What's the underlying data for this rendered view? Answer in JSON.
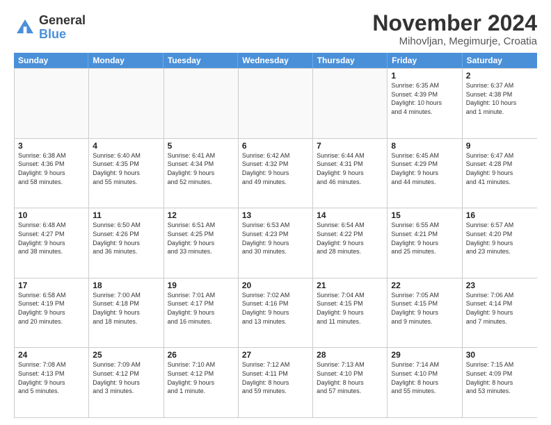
{
  "logo": {
    "general": "General",
    "blue": "Blue"
  },
  "title": "November 2024",
  "subtitle": "Mihovljan, Megimurje, Croatia",
  "headers": [
    "Sunday",
    "Monday",
    "Tuesday",
    "Wednesday",
    "Thursday",
    "Friday",
    "Saturday"
  ],
  "rows": [
    [
      {
        "day": "",
        "info": "",
        "empty": true
      },
      {
        "day": "",
        "info": "",
        "empty": true
      },
      {
        "day": "",
        "info": "",
        "empty": true
      },
      {
        "day": "",
        "info": "",
        "empty": true
      },
      {
        "day": "",
        "info": "",
        "empty": true
      },
      {
        "day": "1",
        "info": "Sunrise: 6:35 AM\nSunset: 4:39 PM\nDaylight: 10 hours\nand 4 minutes.",
        "empty": false
      },
      {
        "day": "2",
        "info": "Sunrise: 6:37 AM\nSunset: 4:38 PM\nDaylight: 10 hours\nand 1 minute.",
        "empty": false
      }
    ],
    [
      {
        "day": "3",
        "info": "Sunrise: 6:38 AM\nSunset: 4:36 PM\nDaylight: 9 hours\nand 58 minutes.",
        "empty": false
      },
      {
        "day": "4",
        "info": "Sunrise: 6:40 AM\nSunset: 4:35 PM\nDaylight: 9 hours\nand 55 minutes.",
        "empty": false
      },
      {
        "day": "5",
        "info": "Sunrise: 6:41 AM\nSunset: 4:34 PM\nDaylight: 9 hours\nand 52 minutes.",
        "empty": false
      },
      {
        "day": "6",
        "info": "Sunrise: 6:42 AM\nSunset: 4:32 PM\nDaylight: 9 hours\nand 49 minutes.",
        "empty": false
      },
      {
        "day": "7",
        "info": "Sunrise: 6:44 AM\nSunset: 4:31 PM\nDaylight: 9 hours\nand 46 minutes.",
        "empty": false
      },
      {
        "day": "8",
        "info": "Sunrise: 6:45 AM\nSunset: 4:29 PM\nDaylight: 9 hours\nand 44 minutes.",
        "empty": false
      },
      {
        "day": "9",
        "info": "Sunrise: 6:47 AM\nSunset: 4:28 PM\nDaylight: 9 hours\nand 41 minutes.",
        "empty": false
      }
    ],
    [
      {
        "day": "10",
        "info": "Sunrise: 6:48 AM\nSunset: 4:27 PM\nDaylight: 9 hours\nand 38 minutes.",
        "empty": false
      },
      {
        "day": "11",
        "info": "Sunrise: 6:50 AM\nSunset: 4:26 PM\nDaylight: 9 hours\nand 36 minutes.",
        "empty": false
      },
      {
        "day": "12",
        "info": "Sunrise: 6:51 AM\nSunset: 4:25 PM\nDaylight: 9 hours\nand 33 minutes.",
        "empty": false
      },
      {
        "day": "13",
        "info": "Sunrise: 6:53 AM\nSunset: 4:23 PM\nDaylight: 9 hours\nand 30 minutes.",
        "empty": false
      },
      {
        "day": "14",
        "info": "Sunrise: 6:54 AM\nSunset: 4:22 PM\nDaylight: 9 hours\nand 28 minutes.",
        "empty": false
      },
      {
        "day": "15",
        "info": "Sunrise: 6:55 AM\nSunset: 4:21 PM\nDaylight: 9 hours\nand 25 minutes.",
        "empty": false
      },
      {
        "day": "16",
        "info": "Sunrise: 6:57 AM\nSunset: 4:20 PM\nDaylight: 9 hours\nand 23 minutes.",
        "empty": false
      }
    ],
    [
      {
        "day": "17",
        "info": "Sunrise: 6:58 AM\nSunset: 4:19 PM\nDaylight: 9 hours\nand 20 minutes.",
        "empty": false
      },
      {
        "day": "18",
        "info": "Sunrise: 7:00 AM\nSunset: 4:18 PM\nDaylight: 9 hours\nand 18 minutes.",
        "empty": false
      },
      {
        "day": "19",
        "info": "Sunrise: 7:01 AM\nSunset: 4:17 PM\nDaylight: 9 hours\nand 16 minutes.",
        "empty": false
      },
      {
        "day": "20",
        "info": "Sunrise: 7:02 AM\nSunset: 4:16 PM\nDaylight: 9 hours\nand 13 minutes.",
        "empty": false
      },
      {
        "day": "21",
        "info": "Sunrise: 7:04 AM\nSunset: 4:15 PM\nDaylight: 9 hours\nand 11 minutes.",
        "empty": false
      },
      {
        "day": "22",
        "info": "Sunrise: 7:05 AM\nSunset: 4:15 PM\nDaylight: 9 hours\nand 9 minutes.",
        "empty": false
      },
      {
        "day": "23",
        "info": "Sunrise: 7:06 AM\nSunset: 4:14 PM\nDaylight: 9 hours\nand 7 minutes.",
        "empty": false
      }
    ],
    [
      {
        "day": "24",
        "info": "Sunrise: 7:08 AM\nSunset: 4:13 PM\nDaylight: 9 hours\nand 5 minutes.",
        "empty": false
      },
      {
        "day": "25",
        "info": "Sunrise: 7:09 AM\nSunset: 4:12 PM\nDaylight: 9 hours\nand 3 minutes.",
        "empty": false
      },
      {
        "day": "26",
        "info": "Sunrise: 7:10 AM\nSunset: 4:12 PM\nDaylight: 9 hours\nand 1 minute.",
        "empty": false
      },
      {
        "day": "27",
        "info": "Sunrise: 7:12 AM\nSunset: 4:11 PM\nDaylight: 8 hours\nand 59 minutes.",
        "empty": false
      },
      {
        "day": "28",
        "info": "Sunrise: 7:13 AM\nSunset: 4:10 PM\nDaylight: 8 hours\nand 57 minutes.",
        "empty": false
      },
      {
        "day": "29",
        "info": "Sunrise: 7:14 AM\nSunset: 4:10 PM\nDaylight: 8 hours\nand 55 minutes.",
        "empty": false
      },
      {
        "day": "30",
        "info": "Sunrise: 7:15 AM\nSunset: 4:09 PM\nDaylight: 8 hours\nand 53 minutes.",
        "empty": false
      }
    ]
  ]
}
